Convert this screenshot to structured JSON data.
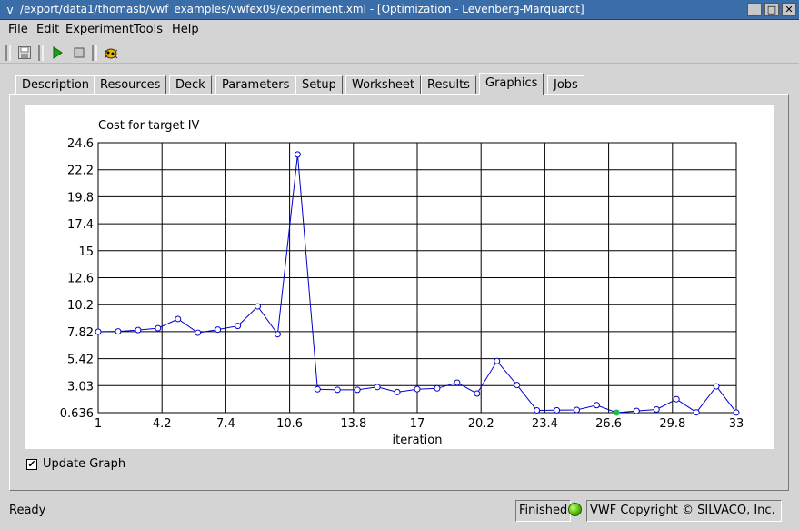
{
  "window": {
    "title": "/export/data1/thomasb/vwf_examples/vwfex09/experiment.xml - [Optimization - Levenberg-Marquardt]",
    "sysmenu_glyph": "v",
    "min_glyph": "_",
    "max_glyph": "□",
    "close_glyph": "✕"
  },
  "menu": [
    "File",
    "Edit",
    "Experiment",
    "Tools",
    "Help"
  ],
  "toolbar": {
    "icons": [
      "save-icon",
      "run-icon",
      "stop-icon",
      "debug-icon"
    ],
    "run_color": "#1aa01a"
  },
  "tabs": [
    "Description",
    "Resources",
    "Deck",
    "Parameters",
    "Setup",
    "Worksheet",
    "Results",
    "Graphics",
    "Jobs"
  ],
  "active_tab": "Graphics",
  "update_graph": {
    "label": "Update Graph",
    "checked": true,
    "mark": "✔"
  },
  "status": {
    "left": "Ready",
    "state": "Finished",
    "indicator_color": "#44b400",
    "copyright": "VWF Copyright ©  SILVACO, Inc."
  },
  "chart_data": {
    "type": "line",
    "title": "Cost for target IV",
    "xlabel": "iteration",
    "ylabel": "",
    "xlim": [
      1,
      33
    ],
    "ylim": [
      0.636,
      24.6
    ],
    "xticks": [
      "1",
      "4.2",
      "7.4",
      "10.6",
      "13.8",
      "17",
      "20.2",
      "23.4",
      "26.6",
      "29.8",
      "33"
    ],
    "yticks": [
      "24.6",
      "22.2",
      "19.8",
      "17.4",
      "15",
      "12.6",
      "10.2",
      "7.82",
      "5.42",
      "3.03",
      "0.636"
    ],
    "grid": true,
    "line_color": "#0000cc",
    "highlight_color": "#22bb55",
    "series": [
      {
        "x": [
          1,
          2,
          3,
          4,
          5,
          6,
          7,
          8,
          9,
          10,
          11,
          12,
          13,
          14,
          15,
          16,
          17,
          18,
          19,
          20,
          21,
          22,
          23,
          24,
          25,
          26,
          27,
          28,
          29,
          30,
          31,
          32,
          33
        ],
        "values": [
          7.82,
          7.85,
          7.97,
          8.13,
          8.95,
          7.73,
          8.01,
          8.33,
          10.07,
          7.6,
          23.56,
          2.71,
          2.66,
          2.66,
          2.91,
          2.46,
          2.72,
          2.79,
          3.3,
          2.33,
          5.21,
          3.09,
          0.84,
          0.85,
          0.88,
          1.3,
          0.64,
          0.79,
          0.92,
          1.83,
          0.66,
          2.97,
          0.65
        ],
        "highlight_index": 26
      }
    ]
  }
}
